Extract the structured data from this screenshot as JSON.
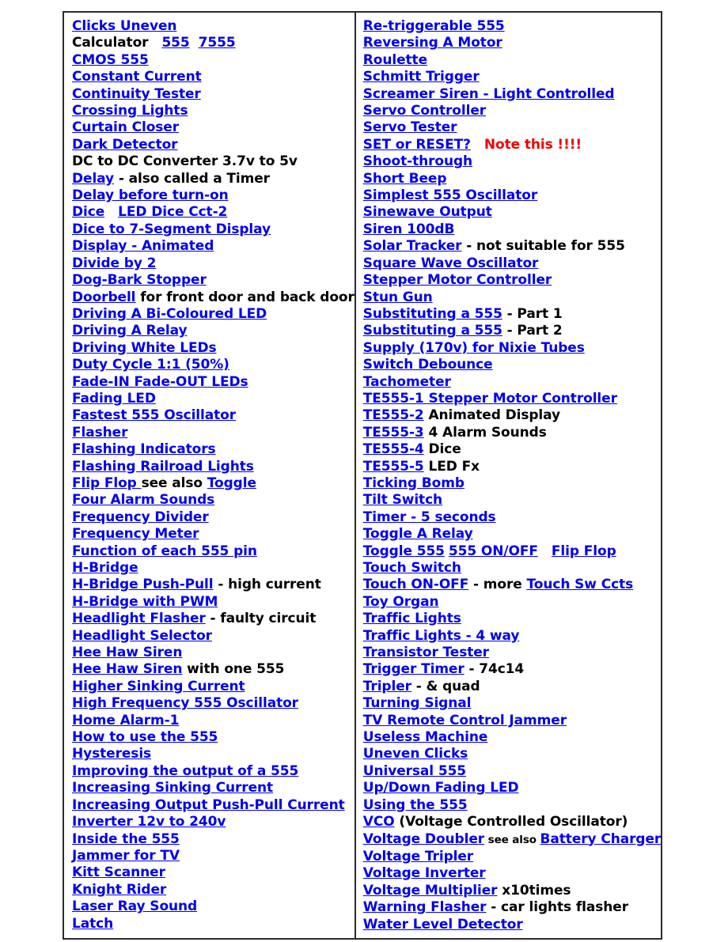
{
  "document": {
    "type": "index-table",
    "title": "555 Circuits Index",
    "columns": 2,
    "link_color": "#0000ee",
    "text_color": "#000000",
    "note_color": "#ee0000",
    "border_color": "#2b2b2b"
  },
  "left_column": [
    {
      "parts": [
        {
          "t": "link",
          "v": "Clicks Uneven"
        }
      ]
    },
    {
      "parts": [
        {
          "t": "text",
          "v": "Calculator"
        },
        {
          "t": "gap",
          "v": "sp3"
        },
        {
          "t": "link",
          "v": "555"
        },
        {
          "t": "gap",
          "v": "sp2"
        },
        {
          "t": "link",
          "v": "7555"
        }
      ]
    },
    {
      "parts": [
        {
          "t": "link",
          "v": "CMOS 555"
        }
      ]
    },
    {
      "parts": [
        {
          "t": "link",
          "v": "Constant Current"
        }
      ]
    },
    {
      "parts": [
        {
          "t": "link",
          "v": "Continuity Tester"
        }
      ]
    },
    {
      "parts": [
        {
          "t": "link",
          "v": "Crossing Lights"
        }
      ]
    },
    {
      "parts": [
        {
          "t": "link",
          "v": "Curtain Closer"
        }
      ]
    },
    {
      "parts": [
        {
          "t": "link",
          "v": "Dark Detector"
        }
      ]
    },
    {
      "parts": [
        {
          "t": "text",
          "v": "DC to DC Converter  3.7v to 5v"
        }
      ]
    },
    {
      "parts": [
        {
          "t": "link",
          "v": "Delay"
        },
        {
          "t": "text",
          "v": " - also called a Timer"
        }
      ]
    },
    {
      "parts": [
        {
          "t": "link",
          "v": "Delay before turn-on"
        }
      ]
    },
    {
      "parts": [
        {
          "t": "link",
          "v": "Dice"
        },
        {
          "t": "gap",
          "v": "sp3"
        },
        {
          "t": "link",
          "v": "LED Dice Cct-2"
        }
      ]
    },
    {
      "parts": [
        {
          "t": "link",
          "v": "Dice to 7-Segment Display"
        }
      ]
    },
    {
      "parts": [
        {
          "t": "link",
          "v": "Display - Animated"
        }
      ]
    },
    {
      "parts": [
        {
          "t": "link",
          "v": "Divide by 2"
        }
      ]
    },
    {
      "parts": [
        {
          "t": "link",
          "v": "Dog-Bark Stopper"
        }
      ]
    },
    {
      "parts": [
        {
          "t": "link",
          "v": "Doorbell"
        },
        {
          "t": "text",
          "v": " for front door and back door"
        }
      ]
    },
    {
      "parts": [
        {
          "t": "link",
          "v": "Driving A Bi-Coloured LED"
        }
      ]
    },
    {
      "parts": [
        {
          "t": "link",
          "v": "Driving A Relay"
        }
      ]
    },
    {
      "parts": [
        {
          "t": "link",
          "v": "Driving White LEDs"
        }
      ]
    },
    {
      "parts": [
        {
          "t": "link",
          "v": "Duty Cycle 1:1   (50%)"
        }
      ]
    },
    {
      "parts": [
        {
          "t": "link",
          "v": "Fade-IN Fade-OUT LEDs"
        }
      ]
    },
    {
      "parts": [
        {
          "t": "link",
          "v": "Fading LED"
        }
      ]
    },
    {
      "parts": [
        {
          "t": "link",
          "v": "Fastest 555 Oscillator"
        }
      ]
    },
    {
      "parts": [
        {
          "t": "link",
          "v": "Flasher"
        }
      ]
    },
    {
      "parts": [
        {
          "t": "link",
          "v": "Flashing Indicators"
        }
      ]
    },
    {
      "parts": [
        {
          "t": "link",
          "v": "Flashing Railroad Lights"
        }
      ]
    },
    {
      "parts": [
        {
          "t": "link",
          "v": "Flip Flop "
        },
        {
          "t": "text",
          "v": "see also "
        },
        {
          "t": "link",
          "v": "Toggle"
        }
      ]
    },
    {
      "parts": [
        {
          "t": "link",
          "v": "Four Alarm Sounds"
        }
      ]
    },
    {
      "parts": [
        {
          "t": "link",
          "v": "Frequency Divider"
        }
      ]
    },
    {
      "parts": [
        {
          "t": "link",
          "v": "Frequency Meter"
        }
      ]
    },
    {
      "parts": [
        {
          "t": "link",
          "v": "Function of each 555 pin"
        }
      ]
    },
    {
      "parts": [
        {
          "t": "link",
          "v": "H-Bridge"
        }
      ]
    },
    {
      "parts": [
        {
          "t": "link",
          "v": "H-Bridge Push-Pull"
        },
        {
          "t": "text",
          "v": " - high current"
        }
      ]
    },
    {
      "parts": [
        {
          "t": "link",
          "v": "H-Bridge with PWM"
        }
      ]
    },
    {
      "parts": [
        {
          "t": "link",
          "v": "Headlight Flasher"
        },
        {
          "t": "text",
          "v": "  - faulty circuit"
        }
      ]
    },
    {
      "parts": [
        {
          "t": "link",
          "v": "Headlight Selector"
        }
      ]
    },
    {
      "parts": [
        {
          "t": "link",
          "v": "Hee Haw Siren"
        }
      ]
    },
    {
      "parts": [
        {
          "t": "link",
          "v": "Hee Haw Siren"
        },
        {
          "t": "text",
          "v": " with one 555"
        }
      ]
    },
    {
      "parts": [
        {
          "t": "link",
          "v": "Higher Sinking Current"
        }
      ]
    },
    {
      "parts": [
        {
          "t": "link",
          "v": "High Frequency 555 Oscillator"
        }
      ]
    },
    {
      "parts": [
        {
          "t": "link",
          "v": "Home Alarm-1"
        }
      ]
    },
    {
      "parts": [
        {
          "t": "link",
          "v": "How to use the 555"
        }
      ]
    },
    {
      "parts": [
        {
          "t": "link",
          "v": "Hysteresis"
        }
      ]
    },
    {
      "parts": [
        {
          "t": "link",
          "v": "Improving the output of a 555"
        }
      ]
    },
    {
      "parts": [
        {
          "t": "link",
          "v": "Increasing Sinking Current"
        }
      ]
    },
    {
      "parts": [
        {
          "t": "link",
          "v": "Increasing Output Push-Pull Current"
        }
      ]
    },
    {
      "parts": [
        {
          "t": "link",
          "v": "Inverter 12v to 240v"
        }
      ]
    },
    {
      "parts": [
        {
          "t": "link",
          "v": "Inside the 555"
        }
      ]
    },
    {
      "parts": [
        {
          "t": "link",
          "v": "Jammer for TV"
        }
      ]
    },
    {
      "parts": [
        {
          "t": "link",
          "v": "Kitt Scanner"
        }
      ]
    },
    {
      "parts": [
        {
          "t": "link",
          "v": "Knight Rider"
        }
      ]
    },
    {
      "parts": [
        {
          "t": "link",
          "v": "Laser Ray Sound"
        }
      ]
    },
    {
      "parts": [
        {
          "t": "link",
          "v": "Latch"
        }
      ]
    }
  ],
  "right_column": [
    {
      "parts": [
        {
          "t": "link",
          "v": "Re-triggerable 555"
        }
      ]
    },
    {
      "parts": [
        {
          "t": "link",
          "v": "Reversing A Motor"
        }
      ]
    },
    {
      "parts": [
        {
          "t": "link",
          "v": "Roulette"
        }
      ]
    },
    {
      "parts": [
        {
          "t": "link",
          "v": "Schmitt Trigger"
        }
      ]
    },
    {
      "parts": [
        {
          "t": "link",
          "v": "Screamer Siren - Light Controlled"
        }
      ]
    },
    {
      "parts": [
        {
          "t": "link",
          "v": "Servo Controller"
        }
      ]
    },
    {
      "parts": [
        {
          "t": "link",
          "v": "Servo Tester"
        }
      ]
    },
    {
      "parts": [
        {
          "t": "link",
          "v": "SET or RESET?"
        },
        {
          "t": "gap",
          "v": "sp3"
        },
        {
          "t": "note",
          "v": "Note this !!!!"
        }
      ]
    },
    {
      "parts": [
        {
          "t": "link",
          "v": "Shoot-through"
        }
      ]
    },
    {
      "parts": [
        {
          "t": "link",
          "v": "Short Beep"
        }
      ]
    },
    {
      "parts": [
        {
          "t": "link",
          "v": "Simplest 555 Oscillator"
        }
      ]
    },
    {
      "parts": [
        {
          "t": "link",
          "v": "Sinewave Output"
        }
      ]
    },
    {
      "parts": [
        {
          "t": "link",
          "v": "Siren 100dB"
        }
      ]
    },
    {
      "parts": [
        {
          "t": "link",
          "v": "Solar Tracker"
        },
        {
          "t": "text",
          "v": " - not suitable for 555"
        }
      ]
    },
    {
      "parts": [
        {
          "t": "link",
          "v": "Square Wave Oscillator"
        }
      ]
    },
    {
      "parts": [
        {
          "t": "link",
          "v": "Stepper Motor Controller"
        }
      ]
    },
    {
      "parts": [
        {
          "t": "link",
          "v": "Stun Gun"
        }
      ]
    },
    {
      "parts": [
        {
          "t": "link",
          "v": "Substituting a 555"
        },
        {
          "t": "text",
          "v": " - Part 1"
        }
      ]
    },
    {
      "parts": [
        {
          "t": "link",
          "v": "Substituting a 555"
        },
        {
          "t": "text",
          "v": " - Part 2"
        }
      ]
    },
    {
      "parts": [
        {
          "t": "link",
          "v": "Supply (170v) for Nixie Tubes"
        }
      ]
    },
    {
      "parts": [
        {
          "t": "link",
          "v": "Switch Debounce"
        }
      ]
    },
    {
      "parts": [
        {
          "t": "link",
          "v": "Tachometer"
        }
      ]
    },
    {
      "parts": [
        {
          "t": "link",
          "v": "TE555-1 Stepper Motor Controller"
        }
      ]
    },
    {
      "parts": [
        {
          "t": "link",
          "v": "TE555-2"
        },
        {
          "t": "text",
          "v": " Animated Display"
        }
      ]
    },
    {
      "parts": [
        {
          "t": "link",
          "v": "TE555-3"
        },
        {
          "t": "text",
          "v": "  4 Alarm Sounds"
        }
      ]
    },
    {
      "parts": [
        {
          "t": "link",
          "v": "TE555-4"
        },
        {
          "t": "text",
          "v": "  Dice"
        }
      ]
    },
    {
      "parts": [
        {
          "t": "link",
          "v": "TE555-5"
        },
        {
          "t": "text",
          "v": "  LED Fx"
        }
      ]
    },
    {
      "parts": [
        {
          "t": "link",
          "v": "Ticking Bomb"
        }
      ]
    },
    {
      "parts": [
        {
          "t": "link",
          "v": "Tilt Switch"
        }
      ]
    },
    {
      "parts": [
        {
          "t": "link",
          "v": "Timer - 5 seconds"
        }
      ]
    },
    {
      "parts": [
        {
          "t": "link",
          "v": "Toggle A Relay"
        }
      ]
    },
    {
      "parts": [
        {
          "t": "link",
          "v": "Toggle 555"
        },
        {
          "t": "gap",
          "v": "sp1"
        },
        {
          "t": "link",
          "v": "555 ON/OFF"
        },
        {
          "t": "gap",
          "v": "sp3"
        },
        {
          "t": "link",
          "v": "Flip Flop"
        }
      ]
    },
    {
      "parts": [
        {
          "t": "link",
          "v": "Touch Switch"
        }
      ]
    },
    {
      "parts": [
        {
          "t": "link",
          "v": "Touch ON-OFF"
        },
        {
          "t": "text",
          "v": "   - more "
        },
        {
          "t": "link",
          "v": "Touch Sw Ccts"
        }
      ]
    },
    {
      "parts": [
        {
          "t": "link",
          "v": "Toy Organ"
        }
      ]
    },
    {
      "parts": [
        {
          "t": "link",
          "v": "Traffic Lights"
        }
      ]
    },
    {
      "parts": [
        {
          "t": "link",
          "v": "Traffic Lights - 4 way"
        }
      ]
    },
    {
      "parts": [
        {
          "t": "link",
          "v": "Transistor Tester"
        }
      ]
    },
    {
      "parts": [
        {
          "t": "link",
          "v": "Trigger Timer"
        },
        {
          "t": "text",
          "v": " - 74c14"
        }
      ]
    },
    {
      "parts": [
        {
          "t": "link",
          "v": "Tripler"
        },
        {
          "t": "text",
          "v": "  -  & quad"
        }
      ]
    },
    {
      "parts": [
        {
          "t": "link",
          "v": "Turning Signal"
        }
      ]
    },
    {
      "parts": [
        {
          "t": "link",
          "v": "TV Remote Control Jammer"
        }
      ]
    },
    {
      "parts": [
        {
          "t": "link",
          "v": "Useless Machine"
        }
      ]
    },
    {
      "parts": [
        {
          "t": "link",
          "v": "Uneven Clicks"
        }
      ]
    },
    {
      "parts": [
        {
          "t": "link",
          "v": "Universal 555"
        }
      ]
    },
    {
      "parts": [
        {
          "t": "link",
          "v": "Up/Down Fading LED"
        }
      ]
    },
    {
      "parts": [
        {
          "t": "link",
          "v": "Using the 555"
        }
      ]
    },
    {
      "parts": [
        {
          "t": "link",
          "v": "VCO"
        },
        {
          "t": "text",
          "v": " (Voltage Controlled Oscillator)"
        }
      ]
    },
    {
      "parts": [
        {
          "t": "link",
          "v": "Voltage Doubler"
        },
        {
          "t": "small",
          "v": " see also "
        },
        {
          "t": "link",
          "v": "Battery Charger"
        }
      ]
    },
    {
      "parts": [
        {
          "t": "link",
          "v": "Voltage Tripler"
        }
      ]
    },
    {
      "parts": [
        {
          "t": "link",
          "v": "Voltage Inverter"
        }
      ]
    },
    {
      "parts": [
        {
          "t": "link",
          "v": "Voltage Multiplier"
        },
        {
          "t": "text",
          "v": " x10times"
        }
      ]
    },
    {
      "parts": [
        {
          "t": "link",
          "v": "Warning Flasher"
        },
        {
          "t": "text",
          "v": " - car lights flasher"
        }
      ]
    },
    {
      "parts": [
        {
          "t": "link",
          "v": "Water Level Detector"
        }
      ]
    }
  ]
}
